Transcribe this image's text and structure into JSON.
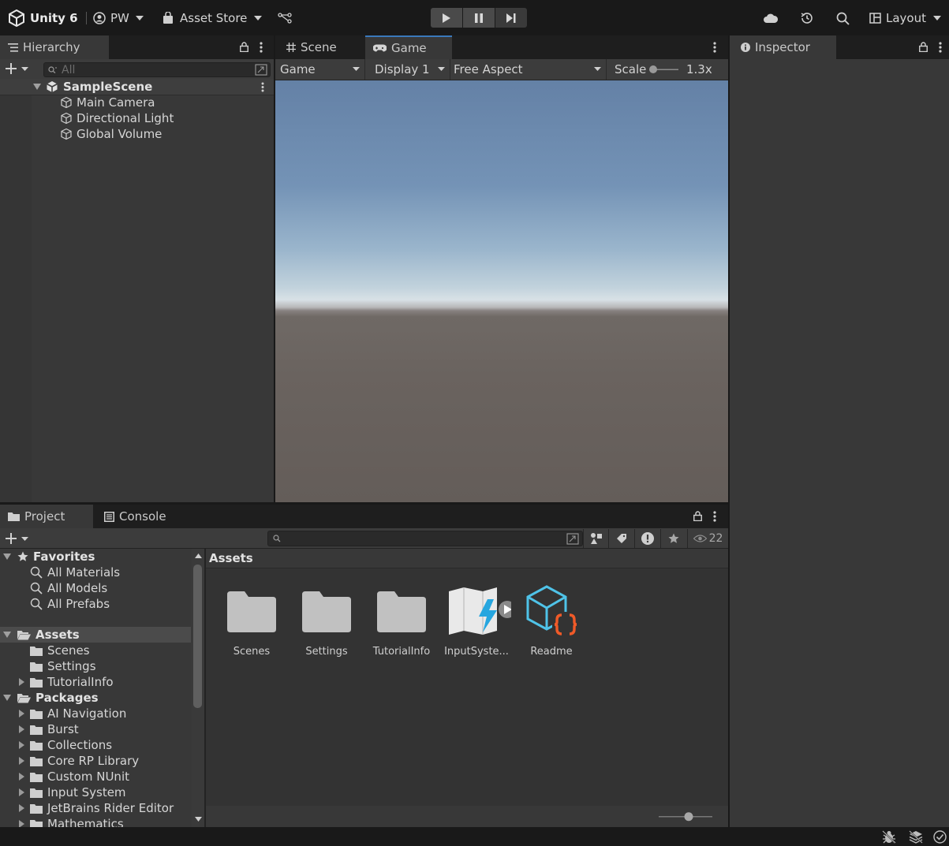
{
  "toolbar": {
    "unity_label": "Unity 6",
    "account_label": "PW",
    "asset_store_label": "Asset Store",
    "layout_label": "Layout"
  },
  "hierarchy": {
    "tab_label": "Hierarchy",
    "search_placeholder": "All",
    "scene_name": "SampleScene",
    "objects": [
      "Main Camera",
      "Directional Light",
      "Global Volume"
    ]
  },
  "center_tabs": {
    "scene_label": "Scene",
    "game_label": "Game"
  },
  "game_toolbar": {
    "mode": "Game",
    "display": "Display 1",
    "aspect": "Free Aspect",
    "scale_label": "Scale",
    "scale_value": "1.3x"
  },
  "inspector": {
    "tab_label": "Inspector"
  },
  "bottom_tabs": {
    "project_label": "Project",
    "console_label": "Console"
  },
  "project": {
    "hidden_count": "22",
    "favorites_label": "Favorites",
    "favorites": [
      "All Materials",
      "All Models",
      "All Prefabs"
    ],
    "assets_label": "Assets",
    "asset_folders": [
      "Scenes",
      "Settings",
      "TutorialInfo"
    ],
    "packages_label": "Packages",
    "packages": [
      "AI Navigation",
      "Burst",
      "Collections",
      "Core RP Library",
      "Custom NUnit",
      "Input System",
      "JetBrains Rider Editor",
      "Mathematics"
    ],
    "breadcrumb": "Assets",
    "grid_items": [
      "Scenes",
      "Settings",
      "TutorialInfo",
      "InputSyste...",
      "Readme"
    ]
  },
  "colors": {
    "accent_blue": "#3a79bb",
    "readme_orange": "#f05a28",
    "readme_cyan": "#4fc3e8"
  }
}
